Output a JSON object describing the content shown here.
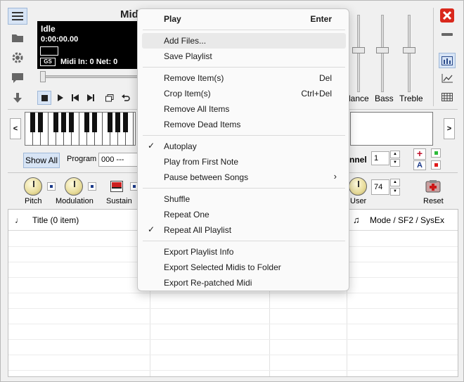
{
  "display": {
    "title": "Mid",
    "status": "Idle",
    "time": "0:00:00.00",
    "gs_badge": "GS",
    "midi_info": "Midi In: 0  Net: 0"
  },
  "controls": {
    "show_all": "Show All",
    "program_label": "Program",
    "program_value": "000 ---",
    "channel_label": "nnel",
    "channel_value": "1",
    "a_button": "A",
    "knob_pitch": "Pitch",
    "knob_modulation": "Modulation",
    "knob_sustain": "Sustain",
    "knob_user": "User",
    "user_value": "74",
    "reset_label": "Reset"
  },
  "mixer": {
    "balance": "lance",
    "bass": "Bass",
    "treble": "Treble"
  },
  "playlist": {
    "col_title": "Title (0 item)",
    "col_mode": "Mode / SF2 / SysEx"
  },
  "menu": {
    "play": "Play",
    "play_key": "Enter",
    "add_files": "Add Files...",
    "save_playlist": "Save Playlist",
    "remove_items": "Remove Item(s)",
    "remove_items_key": "Del",
    "crop_items": "Crop Item(s)",
    "crop_items_key": "Ctrl+Del",
    "remove_all": "Remove All Items",
    "remove_dead": "Remove Dead Items",
    "autoplay": "Autoplay",
    "autoplay_checked": "✓",
    "play_first_note": "Play from First Note",
    "pause_between": "Pause between Songs",
    "submenu_arrow": "›",
    "shuffle": "Shuffle",
    "repeat_one": "Repeat One",
    "repeat_all": "Repeat All Playlist",
    "repeat_all_checked": "✓",
    "export_info": "Export Playlist Info",
    "export_selected": "Export Selected Midis to Folder",
    "export_repatched": "Export Re-patched Midi"
  },
  "colors": {
    "accent_blue": "#d7e4f5",
    "close_red": "#d9281c",
    "lcd_black": "#000000"
  }
}
